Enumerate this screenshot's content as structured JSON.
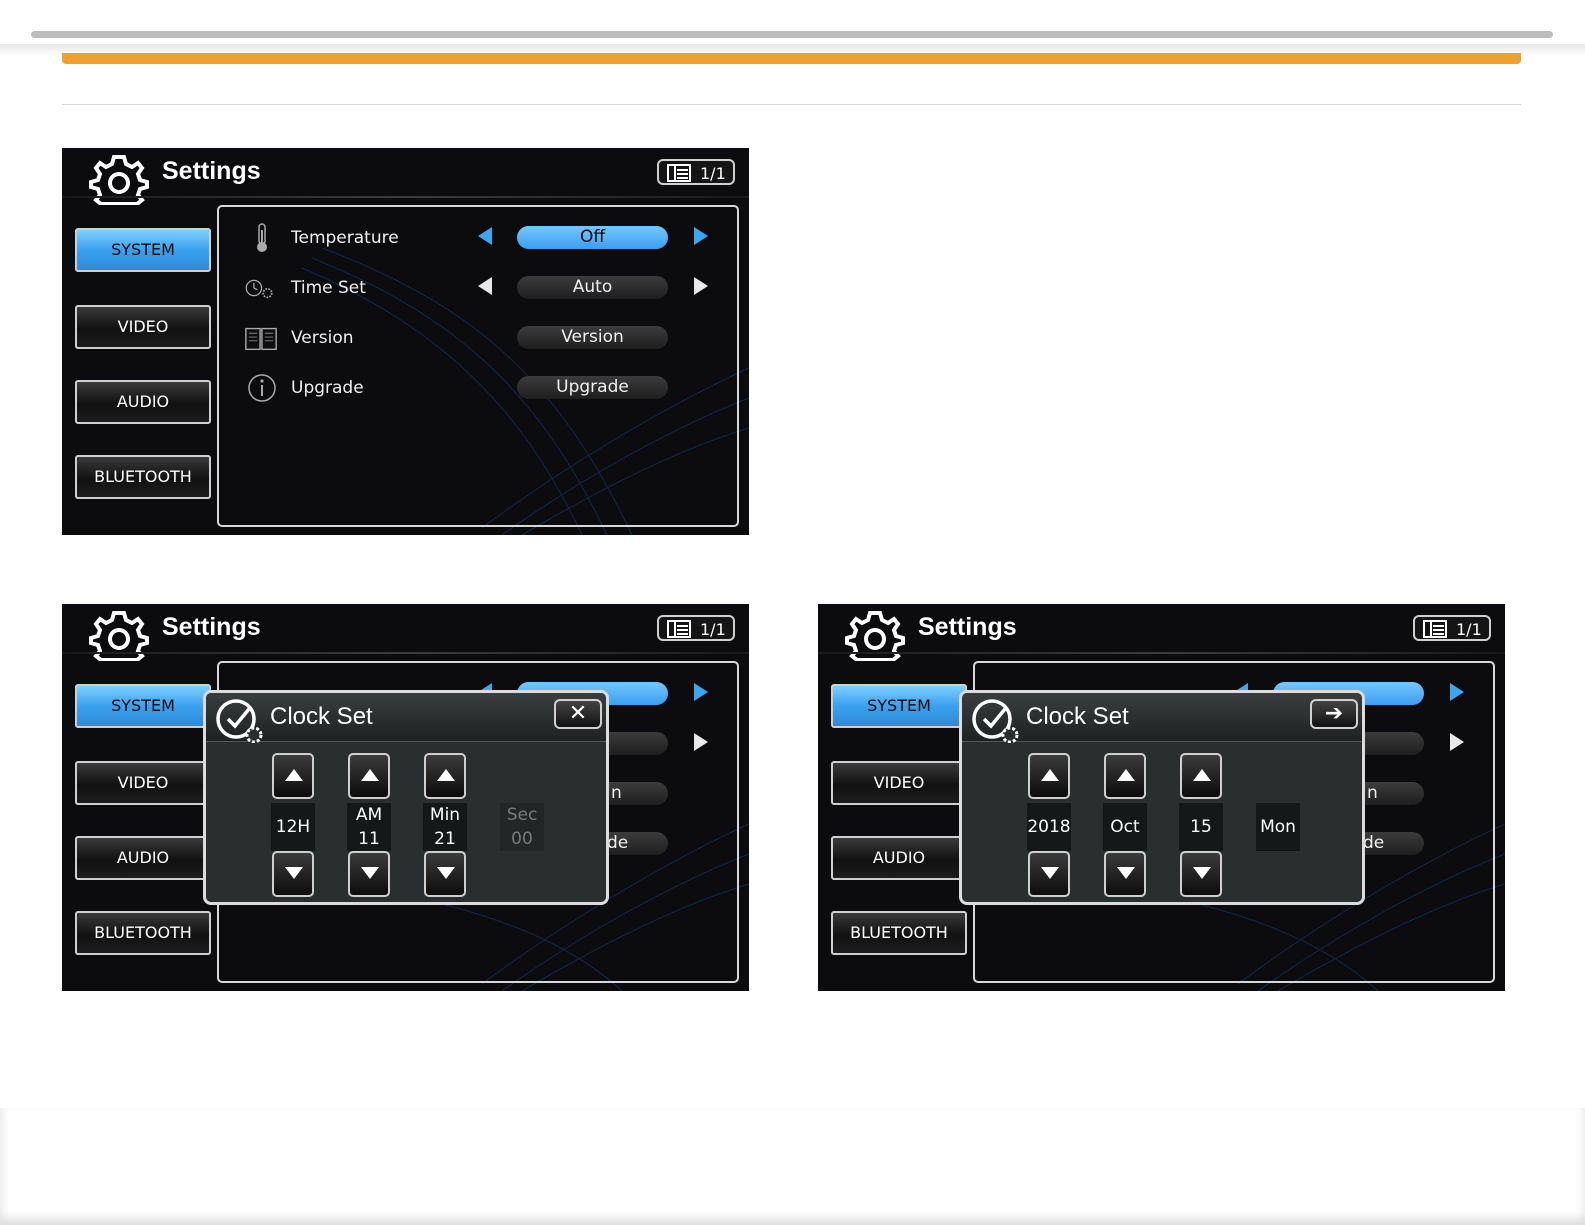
{
  "colors": {
    "accent_orange": "#f0a030",
    "active_blue": "#3aa0ee",
    "screen_bg": "#0c0c0e"
  },
  "screens": [
    {
      "header": {
        "title": "Settings",
        "page_indicator": "1/1",
        "icon": "gear-icon"
      },
      "tabs": [
        {
          "label": "SYSTEM",
          "active": true
        },
        {
          "label": "VIDEO",
          "active": false
        },
        {
          "label": "AUDIO",
          "active": false
        },
        {
          "label": "BLUETOOTH",
          "active": false
        }
      ],
      "rows": [
        {
          "label": "Temperature",
          "icon": "thermometer-icon",
          "value": "Off"
        },
        {
          "label": "Time Set",
          "icon": "alarm-clock-icon",
          "value": "Auto"
        },
        {
          "label": "Version",
          "icon": "book-icon",
          "value": "Version"
        },
        {
          "label": "Upgrade",
          "icon": "info-icon",
          "value": "Upgrade"
        }
      ]
    },
    {
      "header": {
        "title": "Settings",
        "page_indicator": "1/1"
      },
      "tabs": [
        {
          "label": "SYSTEM"
        },
        {
          "label": "VIDEO"
        },
        {
          "label": "AUDIO"
        },
        {
          "label": "BLUETOOTH"
        }
      ],
      "bg_fragments": {
        "version": "n",
        "upgrade": "de"
      },
      "dialog": {
        "title": "Clock Set",
        "action_button": "✕",
        "fields": [
          {
            "line1": "12H",
            "line2": ""
          },
          {
            "line1": "AM",
            "line2": "11"
          },
          {
            "line1": "Min",
            "line2": "21"
          },
          {
            "line1": "Sec",
            "line2": "00"
          }
        ]
      }
    },
    {
      "header": {
        "title": "Settings",
        "page_indicator": "1/1"
      },
      "tabs": [
        {
          "label": "SYSTEM"
        },
        {
          "label": "VIDEO"
        },
        {
          "label": "AUDIO"
        },
        {
          "label": "BLUETOOTH"
        }
      ],
      "bg_fragments": {
        "version": "n",
        "upgrade": "de"
      },
      "dialog": {
        "title": "Clock Set",
        "action_button": "➔",
        "fields": [
          {
            "line1": "2018"
          },
          {
            "line1": "Oct"
          },
          {
            "line1": "15"
          },
          {
            "line1": "Mon"
          }
        ]
      }
    }
  ]
}
